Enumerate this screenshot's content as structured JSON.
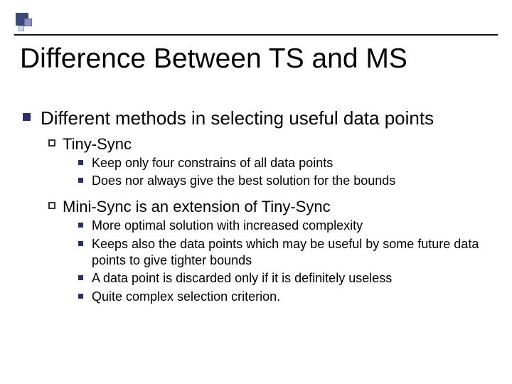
{
  "title": "Difference Between TS and MS",
  "lvl1": {
    "text": "Different methods in selecting useful data points"
  },
  "sections": [
    {
      "heading": "Tiny-Sync",
      "items": [
        "Keep only four constrains of all data points",
        "Does nor always give the best solution for the bounds"
      ]
    },
    {
      "heading": "Mini-Sync is an extension of Tiny-Sync",
      "items": [
        "More optimal solution with increased complexity",
        "Keeps also the data points which may be useful by some future data points to give tighter bounds",
        "A data point is discarded only if it is definitely useless",
        "Quite complex selection criterion."
      ]
    }
  ]
}
